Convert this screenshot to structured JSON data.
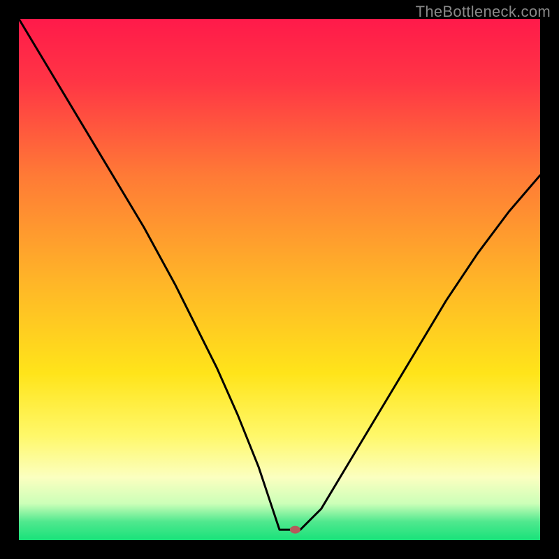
{
  "watermark": "TheBottleneck.com",
  "chart_data": {
    "type": "line",
    "title": "",
    "xlabel": "",
    "ylabel": "",
    "xlim": [
      0,
      100
    ],
    "ylim": [
      0,
      100
    ],
    "grid": false,
    "legend": false,
    "gradient_stops": [
      {
        "offset": 0.0,
        "color": "#ff1a4a"
      },
      {
        "offset": 0.12,
        "color": "#ff3545"
      },
      {
        "offset": 0.3,
        "color": "#ff7a36"
      },
      {
        "offset": 0.5,
        "color": "#ffb428"
      },
      {
        "offset": 0.68,
        "color": "#ffe41a"
      },
      {
        "offset": 0.8,
        "color": "#fff86a"
      },
      {
        "offset": 0.88,
        "color": "#fbffc0"
      },
      {
        "offset": 0.93,
        "color": "#ccffb8"
      },
      {
        "offset": 0.965,
        "color": "#4fe88e"
      },
      {
        "offset": 1.0,
        "color": "#19e27a"
      }
    ],
    "series": [
      {
        "name": "bottleneck-curve",
        "x": [
          0,
          6,
          12,
          18,
          24,
          30,
          34,
          38,
          42,
          46,
          48,
          50,
          52,
          54,
          58,
          64,
          70,
          76,
          82,
          88,
          94,
          100
        ],
        "values": [
          100,
          90,
          80,
          70,
          60,
          49,
          41,
          33,
          24,
          14,
          8,
          3,
          2,
          2,
          6,
          16,
          26,
          36,
          46,
          55,
          63,
          70
        ]
      }
    ],
    "flat_segment": {
      "x_start": 50,
      "x_end": 55,
      "y": 2
    },
    "marker": {
      "x": 53,
      "y": 2,
      "rx": 7,
      "ry": 5,
      "label": "optimal-point"
    }
  }
}
